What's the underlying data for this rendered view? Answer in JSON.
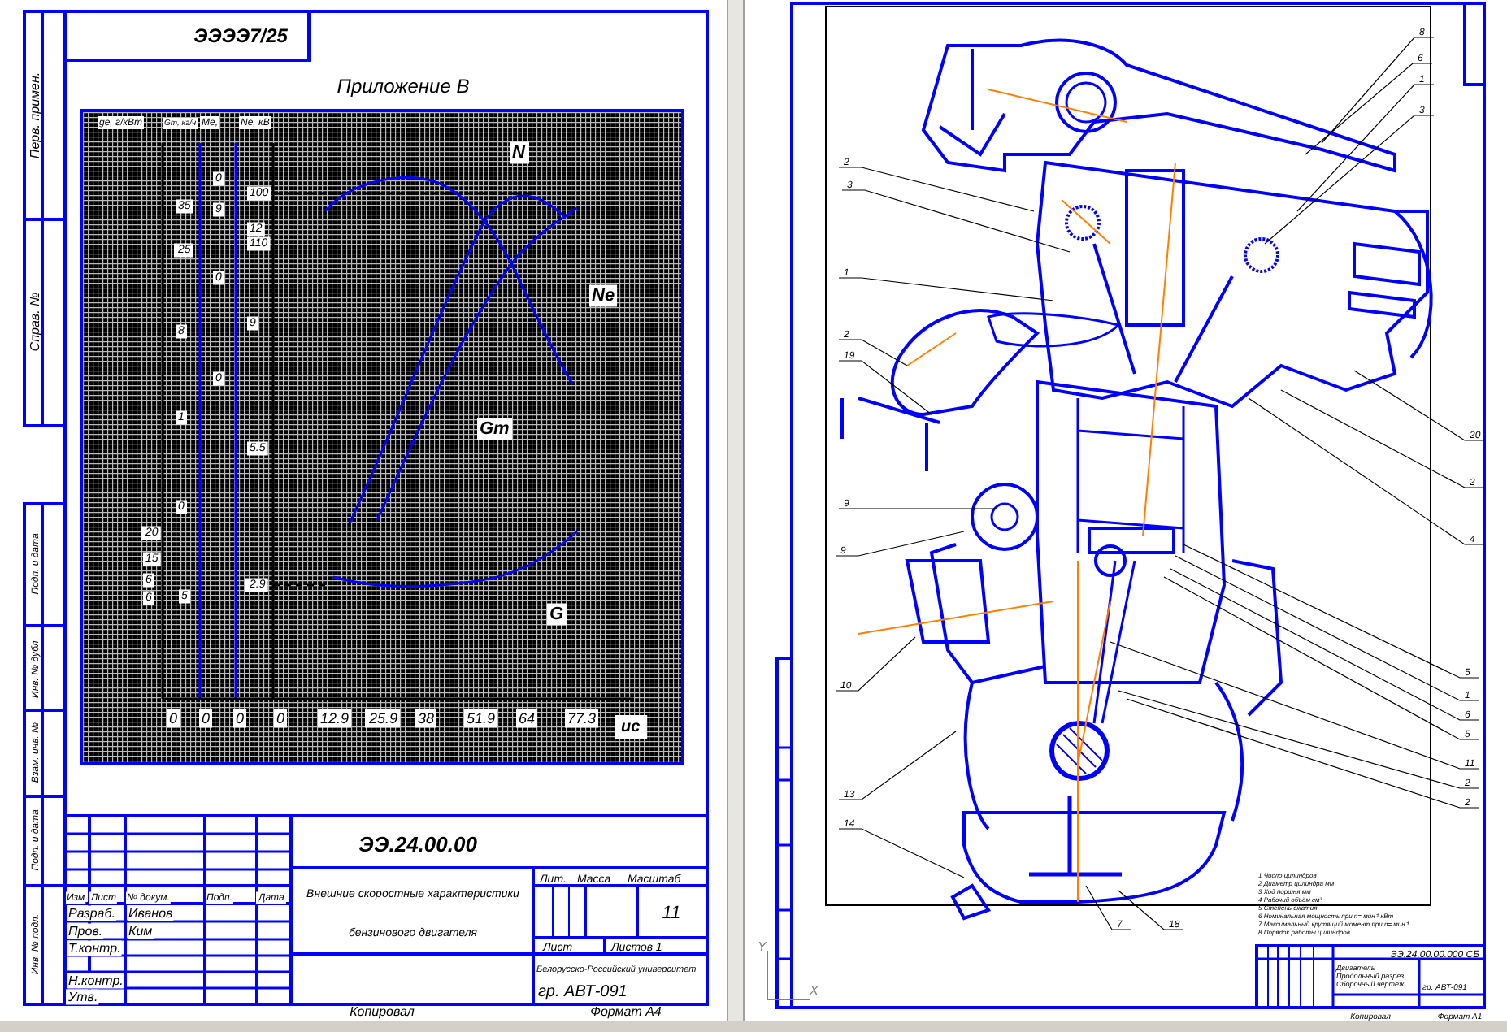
{
  "left_sheet": {
    "stamp": "ЭЭЭЭ7/25",
    "appendix_title": "Приложение В",
    "side_column": [
      "Перв. примен.",
      "Справ. №",
      "Подп. и дата",
      "Инв. № дубл.",
      "Взам. инв. №",
      "Подп. и дата",
      "Инв. № подл."
    ],
    "chart": {
      "axis_headers": [
        "gе, г/кВт",
        "Gт, кг/ч",
        "Ме,",
        "Nе, кВ"
      ],
      "y_tick_labels": [
        "35",
        "25",
        "8",
        "1",
        "0",
        "20",
        "15",
        "6",
        "6",
        "0",
        "9",
        "0",
        "0",
        "5",
        "100",
        "12",
        "110",
        "9",
        "5.5",
        "2.9"
      ],
      "x_tick_labels": [
        "0",
        "0",
        "0",
        "0",
        "12.9",
        "25.9",
        "38",
        "51.9",
        "64",
        "77.3"
      ],
      "x_unit": "ис",
      "curve_labels": [
        "N",
        "Ne",
        "Gт",
        "G"
      ]
    },
    "title_block": {
      "designation": "ЭЭ.24.00.00",
      "header": [
        "Изм",
        "Лист",
        "№ докум.",
        "Подп.",
        "Дата"
      ],
      "roles": [
        "Разраб.",
        "Пров.",
        "Т.контр.",
        "Н.контр.",
        "Утв."
      ],
      "names": [
        "Иванов",
        "Ким"
      ],
      "name_lines": [
        "Внешние скоростные характеристики",
        "бензинового двигателя"
      ],
      "lit_header": [
        "Лит.",
        "Масса",
        "Масштаб"
      ],
      "scale": "11",
      "sheet_header": [
        "Лист",
        "Листов 1"
      ],
      "organization": "Белорусско-Российский университет",
      "group": "гр. АВТ-091"
    },
    "footer": [
      "Копировал",
      "Формат А4"
    ]
  },
  "right_sheet": {
    "leader_numbers": [
      "8",
      "6",
      "1",
      "3",
      "2",
      "3",
      "1",
      "2",
      "19",
      "20",
      "2",
      "4",
      "9",
      "9",
      "10",
      "13",
      "14",
      "7",
      "18",
      "5",
      "1",
      "6",
      "5",
      "11",
      "2",
      "2"
    ],
    "notes": [
      "1  Число цилиндров",
      "2  Диаметр цилиндра   мм",
      "3  Ход поршня   мм",
      "4  Рабочий объём   см³",
      "5  Степень сжатия",
      "6  Номинальная мощность при n=   мин⁻¹   кВт",
      "7  Максимальный крутящий момент при n=   мин⁻¹",
      "8  Порядок работы цилиндров"
    ],
    "title_block": {
      "designation": "ЭЭ.24.00.00.000 СБ",
      "name_lines": [
        "Двигатель",
        "Продольный разрез",
        "Сборочный чертеж"
      ],
      "group": "гр. АВТ-091",
      "footer": [
        "Копировал",
        "Формат А1"
      ]
    },
    "ucs": [
      "Y",
      "X"
    ]
  }
}
